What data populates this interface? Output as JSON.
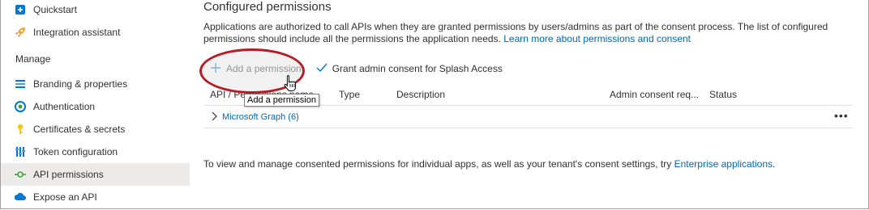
{
  "sidebar": {
    "items": [
      {
        "label": "Quickstart",
        "icon": "quickstart-icon"
      },
      {
        "label": "Integration assistant",
        "icon": "rocket-icon"
      },
      {
        "label": "Branding & properties",
        "icon": "branding-icon"
      },
      {
        "label": "Authentication",
        "icon": "authentication-icon"
      },
      {
        "label": "Certificates & secrets",
        "icon": "key-icon"
      },
      {
        "label": "Token configuration",
        "icon": "token-config-icon"
      },
      {
        "label": "API permissions",
        "icon": "api-permissions-icon"
      },
      {
        "label": "Expose an API",
        "icon": "cloud-icon"
      }
    ],
    "manage_label": "Manage"
  },
  "main": {
    "title": "Configured permissions",
    "description": "Applications are authorized to call APIs when they are granted permissions by users/admins as part of the consent process. The list of configured permissions should include all the permissions the application needs.",
    "description_link": "Learn more about permissions and consent",
    "toolbar": {
      "add_label": "Add a permission",
      "grant_label": "Grant admin consent for Splash Access"
    },
    "tooltip": "Add a permission",
    "table": {
      "columns": [
        "API / Permissions name",
        "Type",
        "Description",
        "Admin consent req...",
        "Status"
      ],
      "rows": [
        {
          "label": "Microsoft Graph (6)"
        }
      ]
    },
    "footer_text": "To view and manage consented permissions for individual apps, as well as your tenant's consent settings, try",
    "footer_link": "Enterprise applications",
    "footer_end": "."
  },
  "colors": {
    "link": "#0067b8",
    "highlight": "#b51c25",
    "active_bg": "#edebe9"
  }
}
